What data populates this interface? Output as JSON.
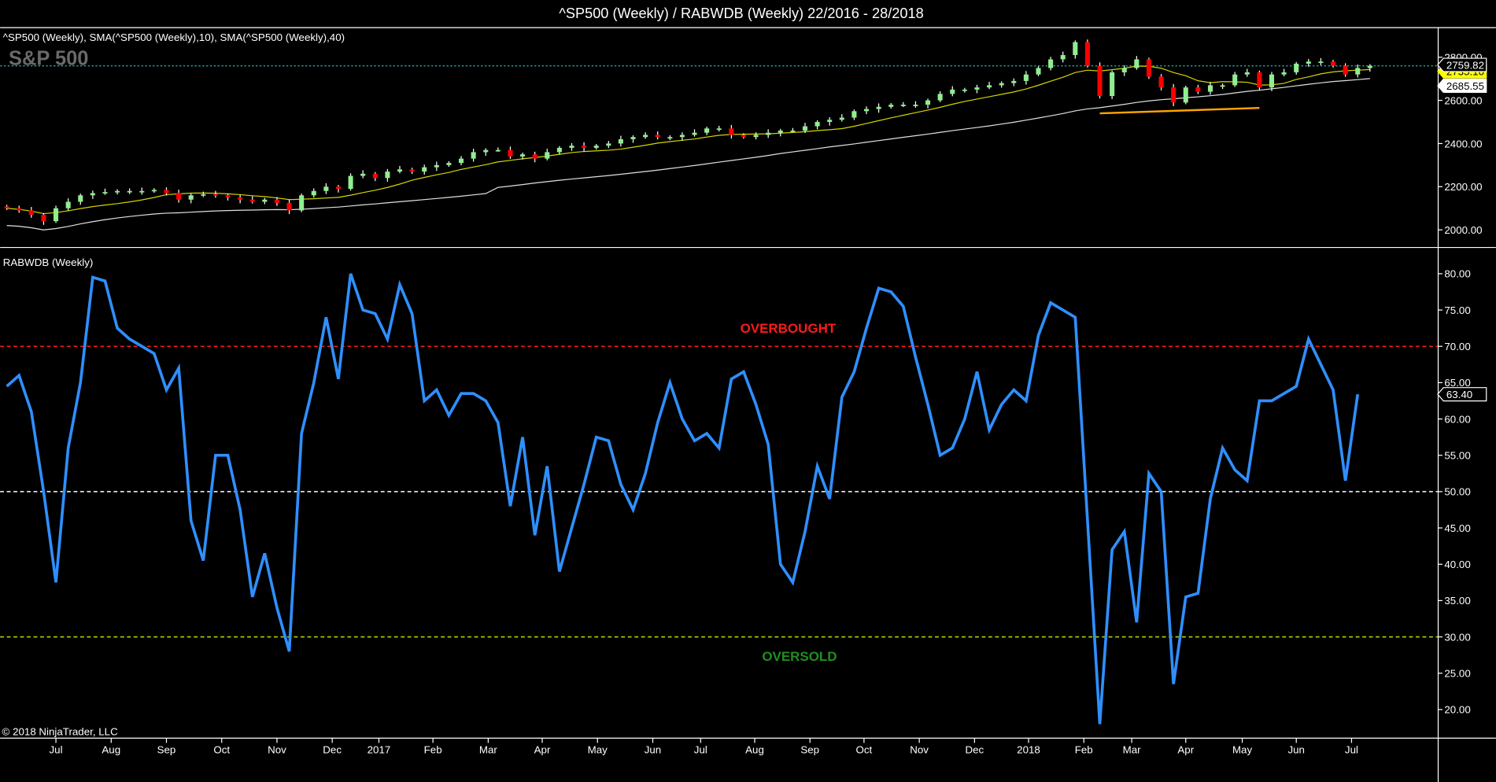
{
  "title": "^SP500 (Weekly) / RABWDB (Weekly)  22/2016 - 28/2018",
  "copyright": "© 2018 NinjaTrader, LLC",
  "colors": {
    "up": "#90ee90",
    "down": "#ff0000",
    "sma10": "#d4d400",
    "sma40": "#e0e0e0",
    "rabwdb": "#2f8fff",
    "overbought": "#ff0000",
    "oversold": "#9acd32",
    "mid": "#ffffff",
    "support": "#ffa500",
    "last_price_line": "#20b2aa"
  },
  "chart_data": [
    {
      "type": "candlestick",
      "panel_label": "^SP500 (Weekly),  SMA(^SP500 (Weekly),10),  SMA(^SP500 (Weekly),40)",
      "watermark": "S&P 500",
      "ylim": [
        1960,
        2900
      ],
      "yticks": [
        "2000.00",
        "2200.00",
        "2400.00",
        "2600.00",
        "2800.00"
      ],
      "ytick_values": [
        2000,
        2200,
        2400,
        2600,
        2800
      ],
      "closes": [
        2100,
        2090,
        2070,
        2040,
        2100,
        2130,
        2160,
        2170,
        2175,
        2180,
        2180,
        2180,
        2185,
        2170,
        2140,
        2160,
        2165,
        2160,
        2150,
        2140,
        2130,
        2140,
        2125,
        2090,
        2160,
        2180,
        2200,
        2190,
        2250,
        2260,
        2240,
        2270,
        2280,
        2270,
        2290,
        2300,
        2310,
        2330,
        2360,
        2370,
        2370,
        2340,
        2350,
        2330,
        2360,
        2380,
        2390,
        2380,
        2390,
        2400,
        2420,
        2430,
        2440,
        2430,
        2430,
        2440,
        2450,
        2470,
        2470,
        2440,
        2430,
        2440,
        2450,
        2460,
        2460,
        2480,
        2500,
        2510,
        2520,
        2550,
        2560,
        2570,
        2580,
        2580,
        2580,
        2600,
        2630,
        2650,
        2650,
        2660,
        2670,
        2680,
        2690,
        2720,
        2750,
        2790,
        2810,
        2870,
        2760,
        2620,
        2730,
        2750,
        2790,
        2710,
        2660,
        2590,
        2660,
        2640,
        2670,
        2670,
        2720,
        2730,
        2660,
        2720,
        2730,
        2770,
        2780,
        2780,
        2760,
        2720,
        2750,
        2760
      ],
      "last_price": "2759.82",
      "sma10_last": "2735.10",
      "sma40_last": "2685.55",
      "support_line": [
        [
          89,
          2540
        ],
        [
          102,
          2565
        ]
      ]
    },
    {
      "type": "line",
      "panel_label": "RABWDB (Weekly)",
      "ylim": [
        16,
        84
      ],
      "yticks": [
        "20.00",
        "25.00",
        "30.00",
        "35.00",
        "40.00",
        "45.00",
        "50.00",
        "55.00",
        "60.00",
        "65.00",
        "70.00",
        "75.00",
        "80.00"
      ],
      "ytick_values": [
        20,
        25,
        30,
        35,
        40,
        45,
        50,
        55,
        60,
        65,
        70,
        75,
        80
      ],
      "values": [
        64.5,
        66,
        61,
        50,
        37.5,
        56,
        65,
        79.5,
        79,
        72.5,
        71,
        70,
        69,
        64,
        67,
        46,
        40.5,
        55,
        55,
        47.5,
        35.5,
        41.5,
        34,
        28,
        58,
        65,
        74,
        65.5,
        80,
        75,
        74.5,
        71,
        78.5,
        74.5,
        62.5,
        64,
        60.5,
        63.5,
        63.5,
        62.5,
        59.5,
        48,
        57.5,
        44,
        53.5,
        39,
        45,
        51,
        57.5,
        57,
        51,
        47.5,
        52.5,
        59.5,
        65,
        60,
        57,
        58,
        56,
        65.5,
        66.5,
        62,
        56.5,
        40,
        37.5,
        44.5,
        53.5,
        49,
        63,
        66.5,
        72.5,
        78,
        77.5,
        75.5,
        68.5,
        62,
        55,
        56,
        60,
        66.5,
        58.5,
        62,
        64,
        62.5,
        71.5,
        76,
        75,
        74,
        46,
        18,
        42,
        44.5,
        32,
        52.5,
        50,
        23.5,
        35.5,
        36,
        49,
        56,
        53,
        51.5,
        62.5,
        62.5,
        63.5,
        64.5,
        71,
        67.5,
        64,
        51.5,
        63.4
      ],
      "last_value": "63.40",
      "levels": [
        {
          "name": "overbought",
          "value": 70,
          "label": "OVERBOUGHT"
        },
        {
          "name": "midline",
          "value": 50,
          "label": ""
        },
        {
          "name": "oversold",
          "value": 30,
          "label": "OVERSOLD"
        }
      ]
    }
  ],
  "x_axis": {
    "labels": [
      "Jul",
      "Aug",
      "Sep",
      "Oct",
      "Nov",
      "Dec",
      "2017",
      "Feb",
      "Mar",
      "Apr",
      "May",
      "Jun",
      "Jul",
      "Aug",
      "Sep",
      "Oct",
      "Nov",
      "Dec",
      "2018",
      "Feb",
      "Mar",
      "Apr",
      "May",
      "Jun",
      "Jul"
    ],
    "label_weeks": [
      4,
      8.5,
      13,
      17.5,
      22,
      26.5,
      30.3,
      34.7,
      39.2,
      43.6,
      48.1,
      52.6,
      56.5,
      60.9,
      65.4,
      69.8,
      74.3,
      78.8,
      83.2,
      87.7,
      91.6,
      96,
      100.6,
      105,
      109.5
    ]
  }
}
